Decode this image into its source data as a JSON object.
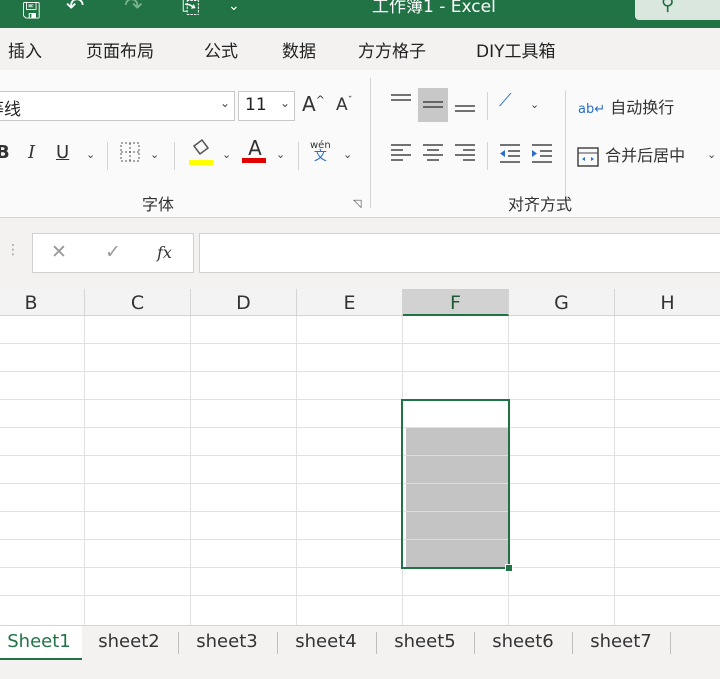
{
  "titlebar": {
    "title": "工作簿1  -  Excel",
    "search_icon": "search-icon"
  },
  "tabs": [
    "插入",
    "页面布局",
    "公式",
    "数据",
    "方方格子",
    "DIY工具箱"
  ],
  "ribbon": {
    "font_name": "等线",
    "font_size": "11",
    "grow_font": "A",
    "shrink_font": "A",
    "bold": "B",
    "italic": "I",
    "underline": "U",
    "font_color_glyph": "A",
    "phonetic_top": "wén",
    "phonetic_bottom": "文",
    "wrap_text": "自动换行",
    "merge_center": "合并后居中",
    "font_group_label": "字体",
    "align_group_label": "对齐方式"
  },
  "formula_bar": {
    "cancel": "✕",
    "enter": "✓",
    "fx": "fx",
    "value": ""
  },
  "columns": [
    "B",
    "C",
    "D",
    "E",
    "F",
    "G",
    "H"
  ],
  "active_column": "F",
  "sheets": [
    "Sheet1",
    "sheet2",
    "sheet3",
    "sheet4",
    "sheet5",
    "sheet6",
    "sheet7"
  ],
  "active_sheet": "Sheet1",
  "colors": {
    "accent": "#217346",
    "fill_highlight": "#ffff00",
    "font_red": "#e00000"
  }
}
